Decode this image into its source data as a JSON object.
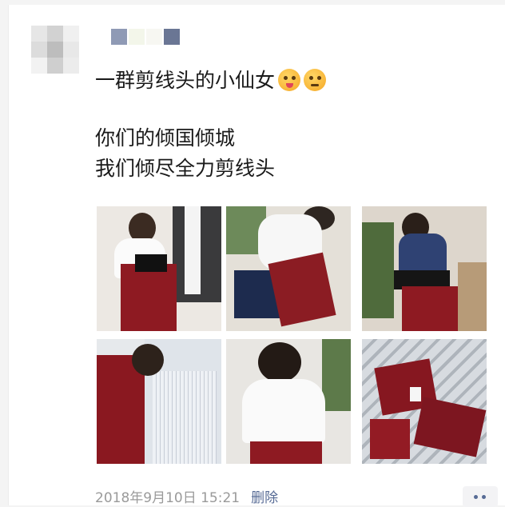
{
  "post": {
    "line1": "一群剪线头的小仙女",
    "line2": "你们的倾国倾城",
    "line3": "我们倾尽全力剪线头",
    "emojis": [
      "face-with-tongue-icon",
      "flushed-face-icon"
    ]
  },
  "photos": [
    {
      "subject": "woman in white blouse cutting threads on red garment"
    },
    {
      "subject": "man in white shirt cutting threads on red garment"
    },
    {
      "subject": "woman in navy top cutting threads"
    },
    {
      "subject": "woman in striped shirt holding red fabric"
    },
    {
      "subject": "woman in white shirt seated working"
    },
    {
      "subject": "red garments wrapped in plastic"
    }
  ],
  "footer": {
    "timestamp": "2018年9月10日 15:21",
    "delete_label": "删除"
  },
  "colors": {
    "link": "#576b95",
    "garment_red": "#8e1a22",
    "text": "#1a1a1a"
  }
}
